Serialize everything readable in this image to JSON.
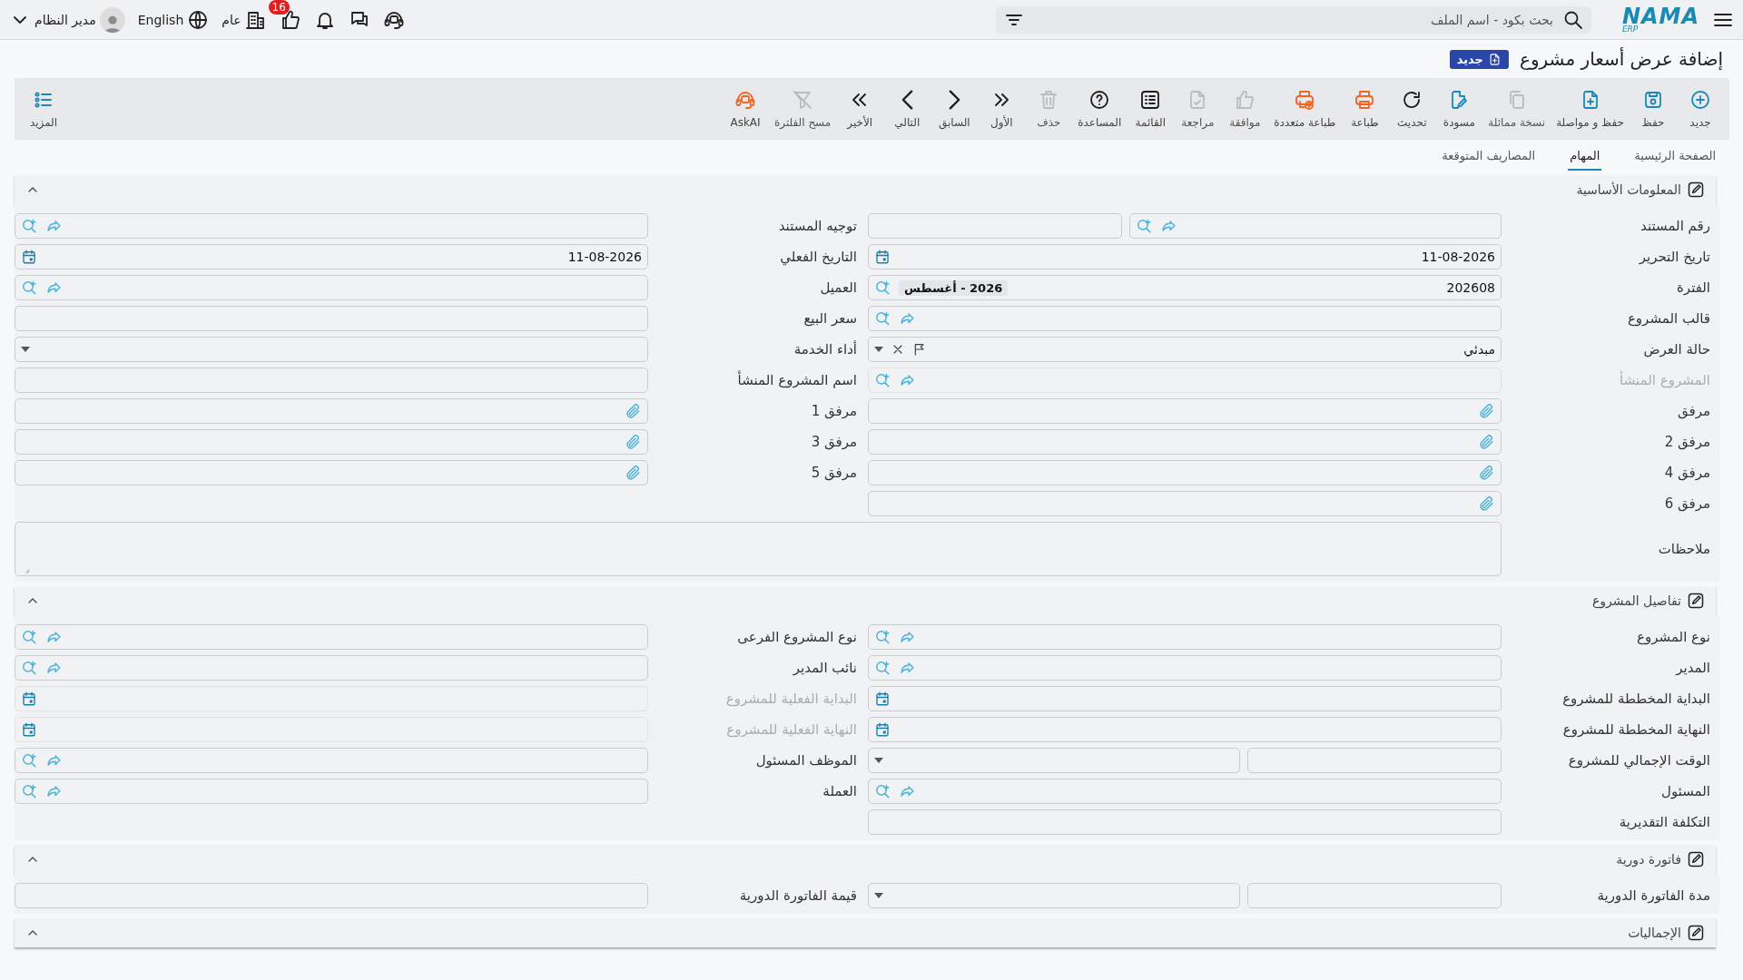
{
  "topbar": {
    "logo": {
      "name": "NAMA",
      "sub": "ERP"
    },
    "search": {
      "placeholder": "بحث بكود - اسم الملف"
    },
    "notifications_badge": "16",
    "branch": "عام",
    "language": "English",
    "user": "مدير النظام"
  },
  "title": "إضافة عرض أسعار مشروع",
  "title_badge": "جديد",
  "toolbar": [
    {
      "kind": "new",
      "label": "جديد",
      "disabled": false
    },
    {
      "kind": "save",
      "label": "حفظ",
      "disabled": false
    },
    {
      "kind": "save-continue",
      "label": "حفظ و مواصلة",
      "disabled": false
    },
    {
      "kind": "duplicate",
      "label": "نسخة مماثلة",
      "disabled": true
    },
    {
      "kind": "draft",
      "label": "مسودة",
      "disabled": false
    },
    {
      "kind": "refresh",
      "label": "تحديث",
      "disabled": false
    },
    {
      "kind": "print",
      "label": "طباعة",
      "disabled": false
    },
    {
      "kind": "multi-print",
      "label": "طباعة متعددة",
      "disabled": false
    },
    {
      "kind": "approve",
      "label": "موافقة",
      "disabled": true
    },
    {
      "kind": "review",
      "label": "مراجعة",
      "disabled": true
    },
    {
      "kind": "list",
      "label": "القائمة",
      "disabled": false
    },
    {
      "kind": "help",
      "label": "المساعدة",
      "disabled": false
    },
    {
      "kind": "delete",
      "label": "حذف",
      "disabled": true
    },
    {
      "kind": "first",
      "label": "الأول",
      "disabled": false
    },
    {
      "kind": "prev",
      "label": "السابق",
      "disabled": false
    },
    {
      "kind": "next",
      "label": "التالي",
      "disabled": false
    },
    {
      "kind": "last",
      "label": "الأخير",
      "disabled": false
    },
    {
      "kind": "clear-filter",
      "label": "مسح الفلترة",
      "disabled": true
    },
    {
      "kind": "ask-ai",
      "label": "AskAI",
      "disabled": false
    }
  ],
  "more": "المزيد",
  "tabs": [
    {
      "label": "الصفحة الرئيسية",
      "selected": false
    },
    {
      "label": "المهام",
      "selected": true
    },
    {
      "label": "المصاريف المتوقعة",
      "selected": false
    }
  ],
  "sections": [
    {
      "title": "المعلومات الأساسية",
      "expanded": true,
      "fields": [
        {
          "label": "رقم المستند",
          "kind": "doc-number",
          "disabled": false
        },
        {
          "label": "توجيه المستند",
          "kind": "lookup",
          "disabled": false
        },
        {
          "label": "تاريخ التحرير",
          "kind": "date",
          "value": "11-08-2026",
          "disabled": false
        },
        {
          "label": "التاريخ الفعلي",
          "kind": "date",
          "value": "11-08-2026",
          "disabled": false
        },
        {
          "label": "الفترة",
          "kind": "period",
          "value": "202608",
          "chip": "2026 - أغسطس",
          "disabled": false
        },
        {
          "label": "العميل",
          "kind": "lookup",
          "disabled": false
        },
        {
          "label": "قالب المشروع",
          "kind": "lookup",
          "disabled": false
        },
        {
          "label": "سعر البيع",
          "kind": "text",
          "disabled": false
        },
        {
          "label": "حالة العرض",
          "kind": "status",
          "value": "مبدئي",
          "disabled": false
        },
        {
          "label": "أداء الخدمة",
          "kind": "dropdown",
          "disabled": false
        },
        {
          "label": "المشروع المنشأ",
          "kind": "lookup",
          "disabled": true
        },
        {
          "label": "اسم المشروع المنشأ",
          "kind": "text",
          "disabled": false
        },
        {
          "label": "مرفق",
          "kind": "attach",
          "disabled": false
        },
        {
          "label": "مرفق 1",
          "kind": "attach",
          "disabled": false
        },
        {
          "label": "مرفق 2",
          "kind": "attach",
          "disabled": false
        },
        {
          "label": "مرفق 3",
          "kind": "attach",
          "disabled": false
        },
        {
          "label": "مرفق 4",
          "kind": "attach",
          "disabled": false
        },
        {
          "label": "مرفق 5",
          "kind": "attach",
          "disabled": false
        },
        {
          "label": "مرفق 6",
          "kind": "attach",
          "disabled": false
        },
        {
          "label": "ملاحظات",
          "kind": "notes",
          "disabled": false
        }
      ]
    },
    {
      "title": "تفاصيل المشروع",
      "expanded": true,
      "fields": [
        {
          "label": "نوع المشروع",
          "kind": "lookup",
          "disabled": false
        },
        {
          "label": "نوع المشروع الفرعى",
          "kind": "lookup",
          "disabled": false
        },
        {
          "label": "المدير",
          "kind": "lookup",
          "disabled": false
        },
        {
          "label": "نائب المدير",
          "kind": "lookup",
          "disabled": false
        },
        {
          "label": "البداية المخططة للمشروع",
          "kind": "date",
          "disabled": false
        },
        {
          "label": "البداية الفعلية للمشروع",
          "kind": "date",
          "disabled": true
        },
        {
          "label": "النهاية المخططة للمشروع",
          "kind": "date",
          "disabled": false
        },
        {
          "label": "النهاية الفعلية للمشروع",
          "kind": "date",
          "disabled": true
        },
        {
          "label": "الوقت الإجمالي للمشروع",
          "kind": "duration",
          "disabled": false
        },
        {
          "label": "الموظف المسئول",
          "kind": "lookup",
          "disabled": false
        },
        {
          "label": "المسئول",
          "kind": "lookup",
          "disabled": false
        },
        {
          "label": "العملة",
          "kind": "lookup",
          "disabled": false
        },
        {
          "label": "التكلفة التقديرية",
          "kind": "text",
          "disabled": false
        }
      ]
    },
    {
      "title": "فاتورة دورية",
      "expanded": true,
      "fields": [
        {
          "label": "مدة الفاتورة الدورية",
          "kind": "duration",
          "disabled": false
        },
        {
          "label": "قيمة الفاتورة الدورية",
          "kind": "text",
          "disabled": false
        }
      ]
    },
    {
      "title": "الإجماليات",
      "expanded": true
    }
  ]
}
